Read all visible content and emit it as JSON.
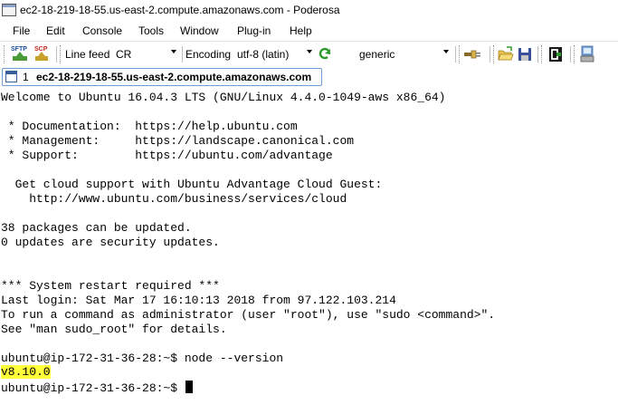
{
  "window": {
    "title": "ec2-18-219-18-55.us-east-2.compute.amazonaws.com - Poderosa",
    "icon": "terminal-app-icon"
  },
  "menu": [
    "File",
    "Edit",
    "Console",
    "Tools",
    "Window",
    "Plug-in",
    "Help"
  ],
  "toolbar": {
    "sftp_label": "SFTP",
    "scp_label": "SCP",
    "line_feed_label": "Line feed",
    "line_feed_value": "CR",
    "encoding_label": "Encoding",
    "encoding_value": "utf-8 (latin)",
    "terminal_type_value": "generic",
    "icons": [
      "refresh-icon",
      "plug-icon",
      "open-folder-icon",
      "save-icon",
      "macro-icon",
      "disconnect-icon"
    ]
  },
  "session_tab": {
    "number": "1",
    "label": "ec2-18-219-18-55.us-east-2.compute.amazonaws.com"
  },
  "terminal": {
    "lines": [
      "Welcome to Ubuntu 16.04.3 LTS (GNU/Linux 4.4.0-1049-aws x86_64)",
      "",
      " * Documentation:  https://help.ubuntu.com",
      " * Management:     https://landscape.canonical.com",
      " * Support:        https://ubuntu.com/advantage",
      "",
      "  Get cloud support with Ubuntu Advantage Cloud Guest:",
      "    http://www.ubuntu.com/business/services/cloud",
      "",
      "38 packages can be updated.",
      "0 updates are security updates.",
      "",
      "",
      "",
      "*** System restart required ***",
      "Last login: Sat Mar 17 16:10:13 2018 from 97.122.103.214",
      "To run a command as administrator (user \"root\"), use \"sudo <command>\".",
      "See \"man sudo_root\" for details.",
      "",
      "ubuntu@ip-172-31-36-28:~$ node --version"
    ],
    "highlighted_output": "v8.10.0",
    "prompt": "ubuntu@ip-172-31-36-28:~$ ",
    "highlight_color": "#ffff3a"
  }
}
